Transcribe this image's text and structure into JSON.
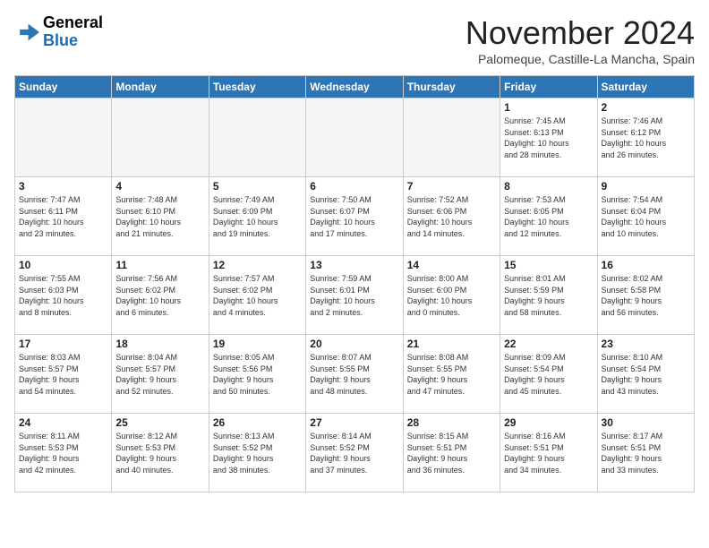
{
  "header": {
    "logo_line1": "General",
    "logo_line2": "Blue",
    "month": "November 2024",
    "location": "Palomeque, Castille-La Mancha, Spain"
  },
  "weekdays": [
    "Sunday",
    "Monday",
    "Tuesday",
    "Wednesday",
    "Thursday",
    "Friday",
    "Saturday"
  ],
  "weeks": [
    [
      {
        "day": "",
        "info": ""
      },
      {
        "day": "",
        "info": ""
      },
      {
        "day": "",
        "info": ""
      },
      {
        "day": "",
        "info": ""
      },
      {
        "day": "",
        "info": ""
      },
      {
        "day": "1",
        "info": "Sunrise: 7:45 AM\nSunset: 6:13 PM\nDaylight: 10 hours\nand 28 minutes."
      },
      {
        "day": "2",
        "info": "Sunrise: 7:46 AM\nSunset: 6:12 PM\nDaylight: 10 hours\nand 26 minutes."
      }
    ],
    [
      {
        "day": "3",
        "info": "Sunrise: 7:47 AM\nSunset: 6:11 PM\nDaylight: 10 hours\nand 23 minutes."
      },
      {
        "day": "4",
        "info": "Sunrise: 7:48 AM\nSunset: 6:10 PM\nDaylight: 10 hours\nand 21 minutes."
      },
      {
        "day": "5",
        "info": "Sunrise: 7:49 AM\nSunset: 6:09 PM\nDaylight: 10 hours\nand 19 minutes."
      },
      {
        "day": "6",
        "info": "Sunrise: 7:50 AM\nSunset: 6:07 PM\nDaylight: 10 hours\nand 17 minutes."
      },
      {
        "day": "7",
        "info": "Sunrise: 7:52 AM\nSunset: 6:06 PM\nDaylight: 10 hours\nand 14 minutes."
      },
      {
        "day": "8",
        "info": "Sunrise: 7:53 AM\nSunset: 6:05 PM\nDaylight: 10 hours\nand 12 minutes."
      },
      {
        "day": "9",
        "info": "Sunrise: 7:54 AM\nSunset: 6:04 PM\nDaylight: 10 hours\nand 10 minutes."
      }
    ],
    [
      {
        "day": "10",
        "info": "Sunrise: 7:55 AM\nSunset: 6:03 PM\nDaylight: 10 hours\nand 8 minutes."
      },
      {
        "day": "11",
        "info": "Sunrise: 7:56 AM\nSunset: 6:02 PM\nDaylight: 10 hours\nand 6 minutes."
      },
      {
        "day": "12",
        "info": "Sunrise: 7:57 AM\nSunset: 6:02 PM\nDaylight: 10 hours\nand 4 minutes."
      },
      {
        "day": "13",
        "info": "Sunrise: 7:59 AM\nSunset: 6:01 PM\nDaylight: 10 hours\nand 2 minutes."
      },
      {
        "day": "14",
        "info": "Sunrise: 8:00 AM\nSunset: 6:00 PM\nDaylight: 10 hours\nand 0 minutes."
      },
      {
        "day": "15",
        "info": "Sunrise: 8:01 AM\nSunset: 5:59 PM\nDaylight: 9 hours\nand 58 minutes."
      },
      {
        "day": "16",
        "info": "Sunrise: 8:02 AM\nSunset: 5:58 PM\nDaylight: 9 hours\nand 56 minutes."
      }
    ],
    [
      {
        "day": "17",
        "info": "Sunrise: 8:03 AM\nSunset: 5:57 PM\nDaylight: 9 hours\nand 54 minutes."
      },
      {
        "day": "18",
        "info": "Sunrise: 8:04 AM\nSunset: 5:57 PM\nDaylight: 9 hours\nand 52 minutes."
      },
      {
        "day": "19",
        "info": "Sunrise: 8:05 AM\nSunset: 5:56 PM\nDaylight: 9 hours\nand 50 minutes."
      },
      {
        "day": "20",
        "info": "Sunrise: 8:07 AM\nSunset: 5:55 PM\nDaylight: 9 hours\nand 48 minutes."
      },
      {
        "day": "21",
        "info": "Sunrise: 8:08 AM\nSunset: 5:55 PM\nDaylight: 9 hours\nand 47 minutes."
      },
      {
        "day": "22",
        "info": "Sunrise: 8:09 AM\nSunset: 5:54 PM\nDaylight: 9 hours\nand 45 minutes."
      },
      {
        "day": "23",
        "info": "Sunrise: 8:10 AM\nSunset: 5:54 PM\nDaylight: 9 hours\nand 43 minutes."
      }
    ],
    [
      {
        "day": "24",
        "info": "Sunrise: 8:11 AM\nSunset: 5:53 PM\nDaylight: 9 hours\nand 42 minutes."
      },
      {
        "day": "25",
        "info": "Sunrise: 8:12 AM\nSunset: 5:53 PM\nDaylight: 9 hours\nand 40 minutes."
      },
      {
        "day": "26",
        "info": "Sunrise: 8:13 AM\nSunset: 5:52 PM\nDaylight: 9 hours\nand 38 minutes."
      },
      {
        "day": "27",
        "info": "Sunrise: 8:14 AM\nSunset: 5:52 PM\nDaylight: 9 hours\nand 37 minutes."
      },
      {
        "day": "28",
        "info": "Sunrise: 8:15 AM\nSunset: 5:51 PM\nDaylight: 9 hours\nand 36 minutes."
      },
      {
        "day": "29",
        "info": "Sunrise: 8:16 AM\nSunset: 5:51 PM\nDaylight: 9 hours\nand 34 minutes."
      },
      {
        "day": "30",
        "info": "Sunrise: 8:17 AM\nSunset: 5:51 PM\nDaylight: 9 hours\nand 33 minutes."
      }
    ]
  ]
}
